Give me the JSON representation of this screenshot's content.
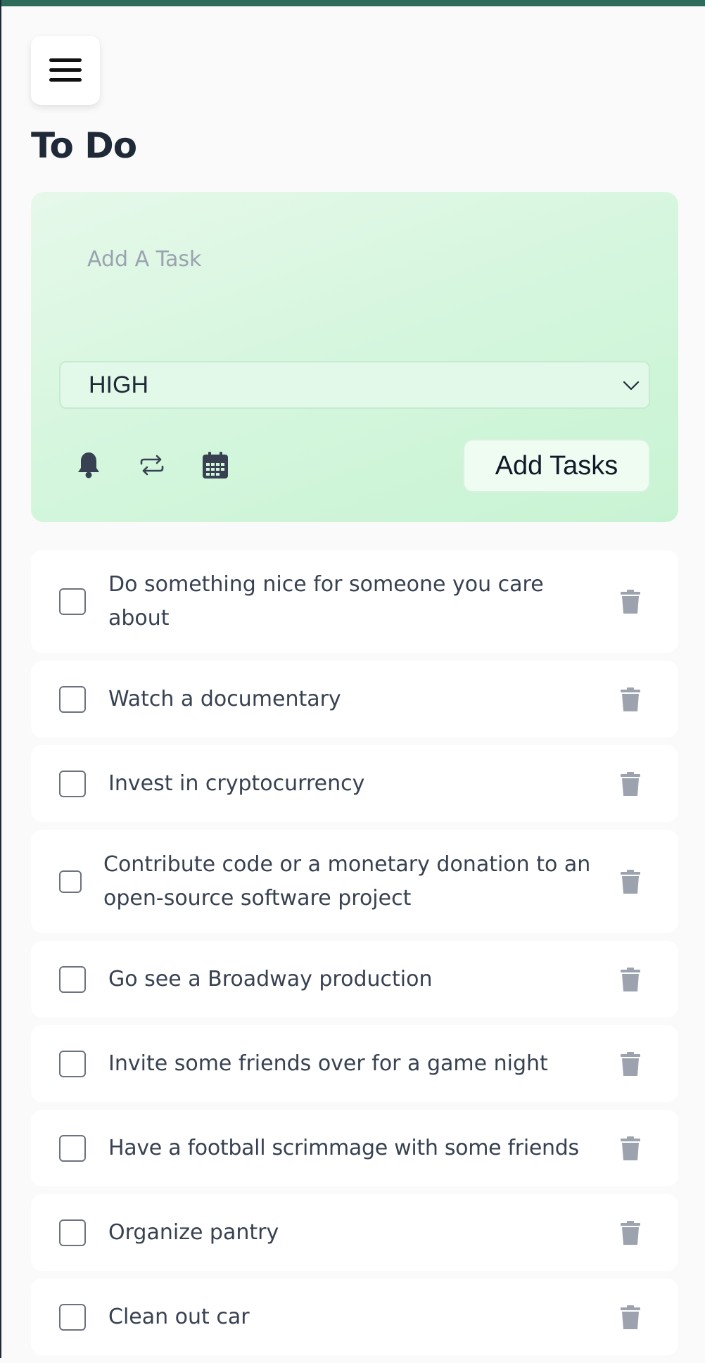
{
  "header": {
    "title": "To Do"
  },
  "add_task": {
    "placeholder": "Add A Task",
    "priority": "HIGH",
    "add_button_label": "Add Tasks",
    "tools": [
      "bell-icon",
      "repeat-icon",
      "calendar-icon"
    ]
  },
  "tasks": [
    {
      "text": "Do something nice for someone you care about",
      "done": false
    },
    {
      "text": "Watch a documentary",
      "done": false
    },
    {
      "text": "Invest in cryptocurrency",
      "done": false
    },
    {
      "text": "Contribute code or a monetary donation to an open-source software project",
      "done": false
    },
    {
      "text": "Go see a Broadway production",
      "done": false
    },
    {
      "text": "Invite some friends over for a game night",
      "done": false
    },
    {
      "text": "Have a football scrimmage with some friends",
      "done": false
    },
    {
      "text": "Organize pantry",
      "done": false
    },
    {
      "text": "Clean out car",
      "done": false
    }
  ],
  "colors": {
    "top_bar": "#2f6b5a",
    "panel": "#d3f6dc",
    "background": "#fafafa",
    "icon_gray": "#9ca3af"
  }
}
